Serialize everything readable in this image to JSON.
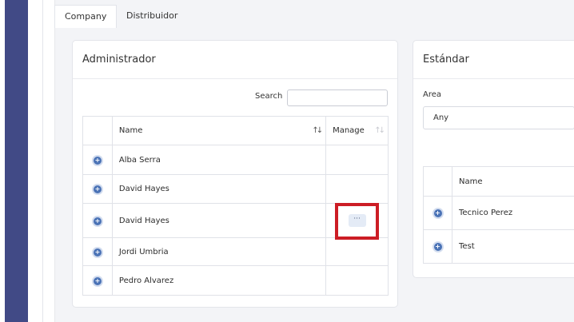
{
  "tabs": [
    {
      "label": "Company",
      "active": true
    },
    {
      "label": "Distribuidor",
      "active": false
    }
  ],
  "admin": {
    "title": "Administrador",
    "search_label": "Search",
    "search_value": "",
    "columns": {
      "name": "Name",
      "manage": "Manage"
    },
    "rows": [
      {
        "name": "Alba Serra"
      },
      {
        "name": "David Hayes"
      },
      {
        "name": "David Hayes",
        "manage_label": "···"
      },
      {
        "name": "Jordi Umbria"
      },
      {
        "name": "Pedro Alvarez"
      }
    ]
  },
  "standard": {
    "title": "Estándar",
    "area_label": "Area",
    "area_value": "Any",
    "columns": {
      "name": "Name"
    },
    "rows": [
      {
        "name": "Tecnico Perez"
      },
      {
        "name": "Test"
      }
    ]
  },
  "colors": {
    "nav": "#414a86",
    "accent": "#4b73b6",
    "highlight": "#cc1d25"
  },
  "icons": {
    "expand": "plus-circle-icon",
    "sort": "sort-arrows-icon"
  }
}
